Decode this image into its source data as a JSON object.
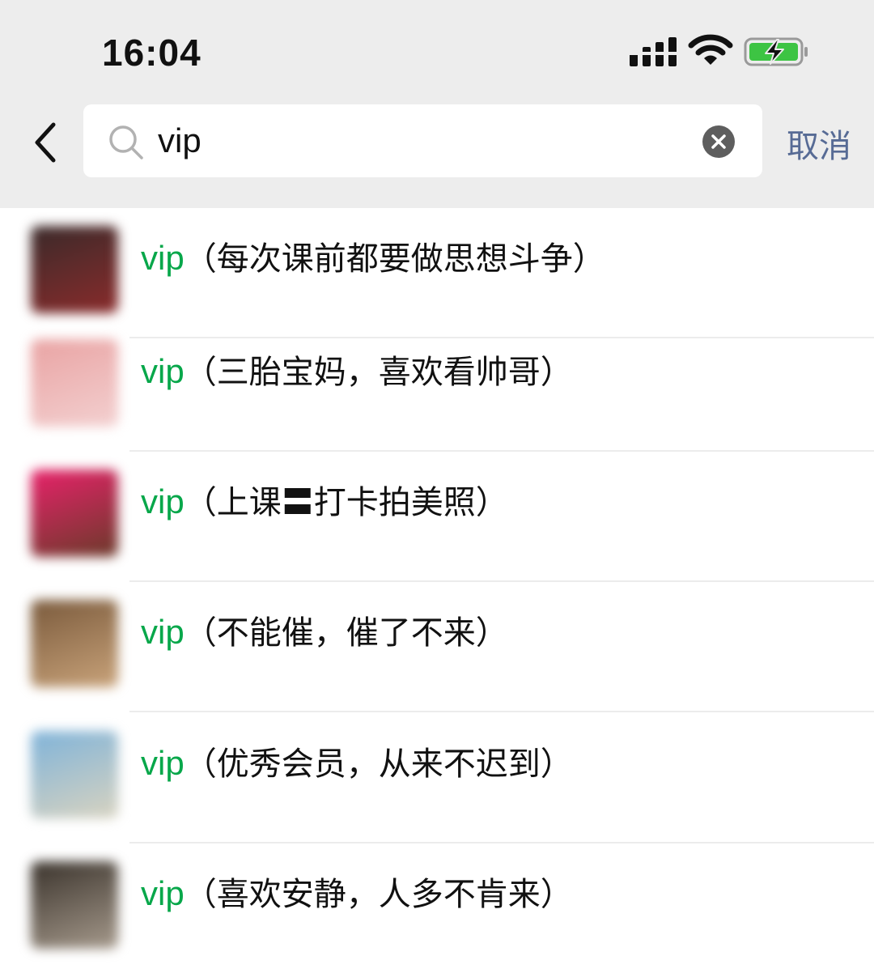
{
  "status_bar": {
    "time": "16:04"
  },
  "search": {
    "query": "vip",
    "cancel_label": "取消"
  },
  "icons": {
    "back": "chevron-left-icon",
    "search": "search-icon",
    "clear": "clear-icon",
    "signal": "signal-icon",
    "wifi": "wifi-icon",
    "battery": "battery-charging-icon"
  },
  "colors": {
    "highlight": "#07a74a",
    "cancel": "#576b95",
    "header_bg": "#ededed",
    "battery": "#3dc443"
  },
  "results": [
    {
      "highlight": "vip",
      "rest": "（每次课前都要做思想斗争）",
      "avatar_colors": [
        "#3a2a2a",
        "#8a2b2b"
      ]
    },
    {
      "highlight": "vip",
      "rest": "（三胎宝妈，喜欢看帅哥）",
      "avatar_colors": [
        "#e9a3a3",
        "#f3d0d0"
      ]
    },
    {
      "highlight": "vip",
      "rest": "（上课〓打卡拍美照）",
      "avatar_colors": [
        "#e8226a",
        "#6b3a2a"
      ]
    },
    {
      "highlight": "vip",
      "rest": "（不能催，催了不来）",
      "avatar_colors": [
        "#7a5a3c",
        "#c9a37a"
      ]
    },
    {
      "highlight": "vip",
      "rest": "（优秀会员，从来不迟到）",
      "avatar_colors": [
        "#7fb3d9",
        "#d8d3c0"
      ]
    },
    {
      "highlight": "vip",
      "rest": "（喜欢安静，人多不肯来）",
      "avatar_colors": [
        "#3a332c",
        "#a69a8c"
      ]
    }
  ]
}
